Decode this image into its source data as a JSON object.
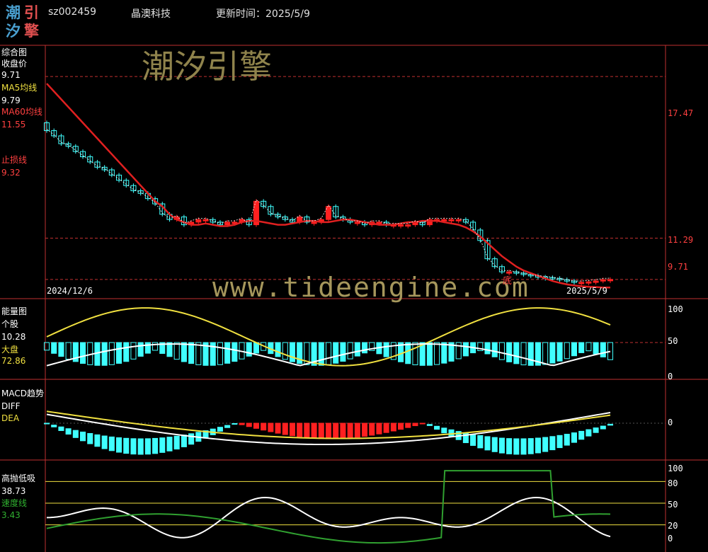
{
  "header": {
    "logo_chars": [
      "潮",
      "引",
      "汐",
      "擎"
    ],
    "code": "sz002459",
    "name": "晶澳科技",
    "updated": "更新时间：2025/5/9"
  },
  "watermarks": {
    "cn": "潮汐引擎",
    "url": "www.tideengine.com"
  },
  "colors": {
    "bg": "#000000",
    "grid": "#c03030",
    "up": "#ff2020",
    "down": "#40ffff",
    "ma5": "#ffffff",
    "ma60": "#e02020",
    "yellow": "#f0e040",
    "green": "#30a030"
  },
  "panel1": {
    "title": "综合图",
    "items": [
      {
        "label": "收盘价",
        "value": "9.71"
      },
      {
        "label": "MA5均线",
        "value": "9.79"
      },
      {
        "label": "MA60均线",
        "value": "11.55"
      },
      {
        "label": "止损线",
        "value": "9.32"
      }
    ],
    "axis_labels": [
      "17.47",
      "11.29",
      "9.71"
    ],
    "date_start": "2024/12/6",
    "date_end": "2025/5/9",
    "marker": "底"
  },
  "panel2": {
    "title": "能量图",
    "items": [
      {
        "label": "个股",
        "value": "10.28"
      },
      {
        "label": "大盘",
        "value": "72.86"
      }
    ],
    "axis_labels": [
      "100",
      "50",
      "0"
    ]
  },
  "panel3": {
    "title": "MACD趋势",
    "items": [
      {
        "label": "DIFF"
      },
      {
        "label": "DEA"
      }
    ],
    "axis_labels": [
      "0"
    ]
  },
  "panel4": {
    "title": "高抛低吸",
    "items": [
      {
        "label": "",
        "value": "38.73"
      },
      {
        "label": "速度线",
        "value": "3.43"
      }
    ],
    "axis_labels": [
      "100",
      "80",
      "50",
      "20",
      "0"
    ]
  },
  "chart_data": [
    {
      "type": "candlestick",
      "ylim": [
        9.3,
        18.5
      ],
      "reference_lines": [
        17.47,
        11.29,
        9.71
      ],
      "close": [
        15.4,
        15.2,
        14.9,
        14.8,
        14.6,
        14.4,
        14.2,
        14.0,
        13.9,
        13.7,
        13.5,
        13.3,
        13.1,
        13.0,
        12.8,
        12.6,
        12.2,
        12.0,
        12.1,
        11.8,
        11.9,
        12.0,
        12.0,
        11.9,
        11.8,
        11.9,
        11.9,
        12.0,
        11.8,
        12.7,
        12.5,
        12.2,
        12.1,
        12.0,
        11.9,
        12.1,
        11.9,
        11.9,
        12.0,
        12.5,
        12.1,
        12.0,
        11.9,
        11.9,
        11.8,
        11.9,
        11.9,
        11.8,
        11.8,
        11.8,
        11.8,
        11.9,
        11.8,
        12.0,
        12.0,
        12.0,
        12.0,
        12.0,
        11.9,
        11.6,
        11.2,
        10.5,
        10.2,
        10.0,
        10.0,
        9.95,
        9.9,
        9.85,
        9.8,
        9.78,
        9.75,
        9.7,
        9.65,
        9.6,
        9.6,
        9.62,
        9.65,
        9.7,
        9.71
      ],
      "ma60": [
        17.2,
        16.9,
        16.6,
        16.3,
        16.0,
        15.7,
        15.4,
        15.1,
        14.8,
        14.5,
        14.2,
        13.9,
        13.6,
        13.3,
        13.0,
        12.7,
        12.5,
        12.2,
        12.0,
        11.9,
        11.8,
        11.8,
        11.85,
        11.8,
        11.75,
        11.75,
        11.8,
        11.9,
        11.95,
        11.95,
        11.9,
        11.85,
        11.8,
        11.8,
        11.85,
        11.9,
        11.95,
        11.95,
        11.9,
        11.9,
        11.95,
        12.0,
        12.0,
        11.95,
        11.9,
        11.85,
        11.8,
        11.8,
        11.8,
        11.85,
        11.9,
        11.9,
        11.95,
        11.95,
        11.95,
        11.9,
        11.85,
        11.8,
        11.7,
        11.55,
        11.35,
        11.1,
        10.85,
        10.6,
        10.4,
        10.2,
        10.05,
        9.95,
        9.85,
        9.75,
        9.65,
        9.58,
        9.52,
        9.48,
        9.45,
        9.43,
        9.42,
        9.4,
        9.4
      ]
    },
    {
      "type": "bar+line",
      "ylim": [
        0,
        100
      ],
      "series": [
        {
          "name": "个股"
        },
        {
          "name": "大盘"
        }
      ]
    },
    {
      "type": "bar+line",
      "series": [
        {
          "name": "DIFF"
        },
        {
          "name": "DEA"
        }
      ]
    },
    {
      "type": "line",
      "ylim": [
        0,
        100
      ],
      "reference_lines": [
        80,
        50,
        20
      ]
    }
  ]
}
